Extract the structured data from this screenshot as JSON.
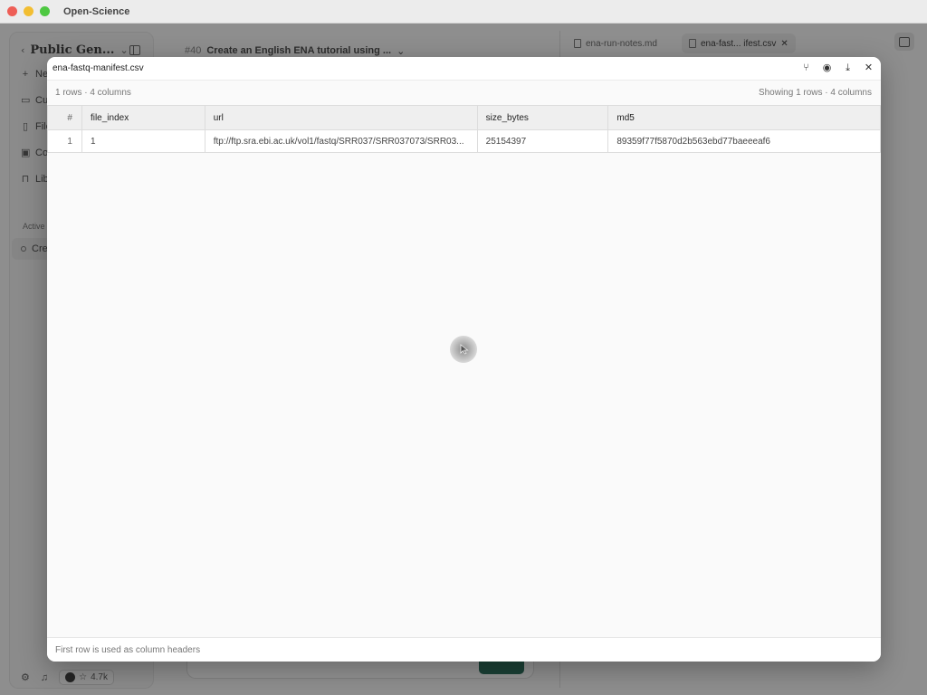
{
  "window": {
    "app_title": "Open-Science"
  },
  "sidebar": {
    "project_title": "Public Gen...",
    "items": [
      {
        "label": "Ne",
        "icon": "plus-icon"
      },
      {
        "label": "Cu",
        "icon": "inbox-icon"
      },
      {
        "label": "File",
        "icon": "files-icon"
      },
      {
        "label": "Co",
        "icon": "compute-icon"
      },
      {
        "label": "Lib",
        "icon": "book-icon"
      }
    ],
    "active_section": "Active",
    "active_item": "Cre",
    "github_stars": "4.7k"
  },
  "chat": {
    "number": "#40",
    "title": "Create an English ENA tutorial using ..."
  },
  "right_tabs": [
    {
      "label": "ena-run-notes.md",
      "active": false
    },
    {
      "label": "ena-fast... ifest.csv",
      "active": true
    }
  ],
  "modal": {
    "title": "ena-fastq-manifest.csv",
    "info_left": "1 rows · 4 columns",
    "info_right": "Showing 1 rows · 4 columns",
    "footer": "First row is used as column headers",
    "table": {
      "headers": [
        "#",
        "file_index",
        "url",
        "size_bytes",
        "md5"
      ],
      "rows": [
        [
          "1",
          "1",
          "ftp://ftp.sra.ebi.ac.uk/vol1/fastq/SRR037/SRR037073/SRR03...",
          "25154397",
          "89359f77f5870d2b563ebd77baeeeaf6"
        ]
      ]
    }
  },
  "colors": {
    "send_button": "#0e5a45",
    "overlay": "#7f7f7f"
  }
}
